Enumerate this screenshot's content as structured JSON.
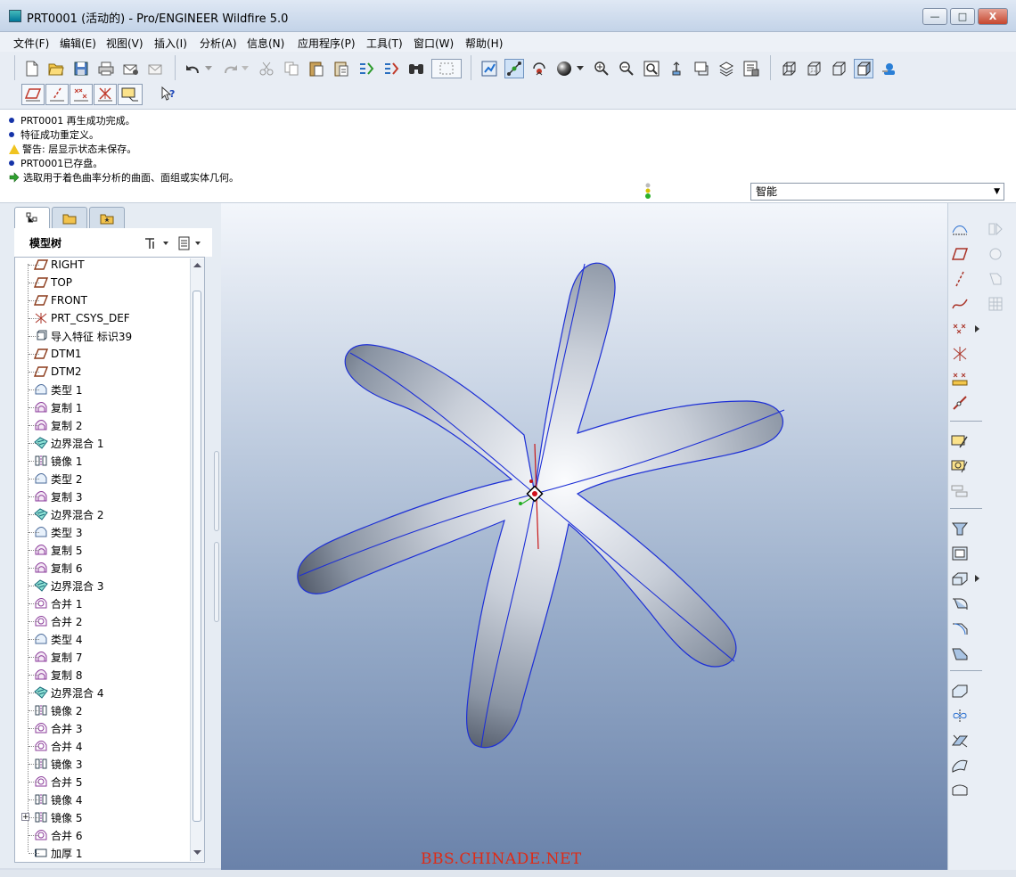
{
  "window": {
    "title": "PRT0001 (活动的) - Pro/ENGINEER Wildfire 5.0",
    "minimize_label": "—",
    "maximize_label": "□",
    "close_label": "X"
  },
  "menubar": {
    "items": [
      "文件(F)",
      "编辑(E)",
      "视图(V)",
      "插入(I)",
      "分析(A)",
      "信息(N)",
      "应用程序(P)",
      "工具(T)",
      "窗口(W)",
      "帮助(H)"
    ]
  },
  "messages": [
    {
      "type": "info",
      "text": "PRT0001 再生成功完成。"
    },
    {
      "type": "info",
      "text": "特征成功重定义。"
    },
    {
      "type": "warning",
      "text": "警告: 层显示状态未保存。"
    },
    {
      "type": "info",
      "text": "PRT0001已存盘。"
    },
    {
      "type": "prompt",
      "text": "选取用于着色曲率分析的曲面、面组或实体几何。"
    }
  ],
  "filter": {
    "value": "智能"
  },
  "model_tree": {
    "title": "模型树",
    "items": [
      {
        "label": "RIGHT",
        "icon": "datum-plane-icon"
      },
      {
        "label": "TOP",
        "icon": "datum-plane-icon"
      },
      {
        "label": "FRONT",
        "icon": "datum-plane-icon"
      },
      {
        "label": "PRT_CSYS_DEF",
        "icon": "csys-icon"
      },
      {
        "label": "导入特征 标识39",
        "icon": "import-feature-icon"
      },
      {
        "label": "DTM1",
        "icon": "datum-plane-icon"
      },
      {
        "label": "DTM2",
        "icon": "datum-plane-icon"
      },
      {
        "label": "类型 1",
        "icon": "surface-type-icon"
      },
      {
        "label": "复制 1",
        "icon": "copy-icon"
      },
      {
        "label": "复制 2",
        "icon": "copy-icon"
      },
      {
        "label": "边界混合 1",
        "icon": "boundary-blend-icon"
      },
      {
        "label": "镜像 1",
        "icon": "mirror-icon"
      },
      {
        "label": "类型 2",
        "icon": "surface-type-icon"
      },
      {
        "label": "复制 3",
        "icon": "copy-icon"
      },
      {
        "label": "边界混合 2",
        "icon": "boundary-blend-icon"
      },
      {
        "label": "类型 3",
        "icon": "surface-type-icon"
      },
      {
        "label": "复制 5",
        "icon": "copy-icon"
      },
      {
        "label": "复制 6",
        "icon": "copy-icon"
      },
      {
        "label": "边界混合 3",
        "icon": "boundary-blend-icon"
      },
      {
        "label": "合并 1",
        "icon": "merge-icon"
      },
      {
        "label": "合并 2",
        "icon": "merge-icon"
      },
      {
        "label": "类型 4",
        "icon": "surface-type-icon"
      },
      {
        "label": "复制 7",
        "icon": "copy-icon"
      },
      {
        "label": "复制 8",
        "icon": "copy-icon"
      },
      {
        "label": "边界混合 4",
        "icon": "boundary-blend-icon"
      },
      {
        "label": "镜像 2",
        "icon": "mirror-icon"
      },
      {
        "label": "合并 3",
        "icon": "merge-icon"
      },
      {
        "label": "合并 4",
        "icon": "merge-icon"
      },
      {
        "label": "镜像 3",
        "icon": "mirror-icon"
      },
      {
        "label": "合并 5",
        "icon": "merge-icon"
      },
      {
        "label": "镜像 4",
        "icon": "mirror-icon"
      },
      {
        "label": "镜像 5",
        "icon": "mirror-icon"
      },
      {
        "label": "合并 6",
        "icon": "merge-icon"
      },
      {
        "label": "加厚 1",
        "icon": "thicken-icon"
      }
    ]
  },
  "watermark": "BBS.CHINADE.NET",
  "colors": {
    "accent_blue": "#1533a8",
    "watermark_red": "#e02a14",
    "edge_blue": "#1d2fd6"
  }
}
